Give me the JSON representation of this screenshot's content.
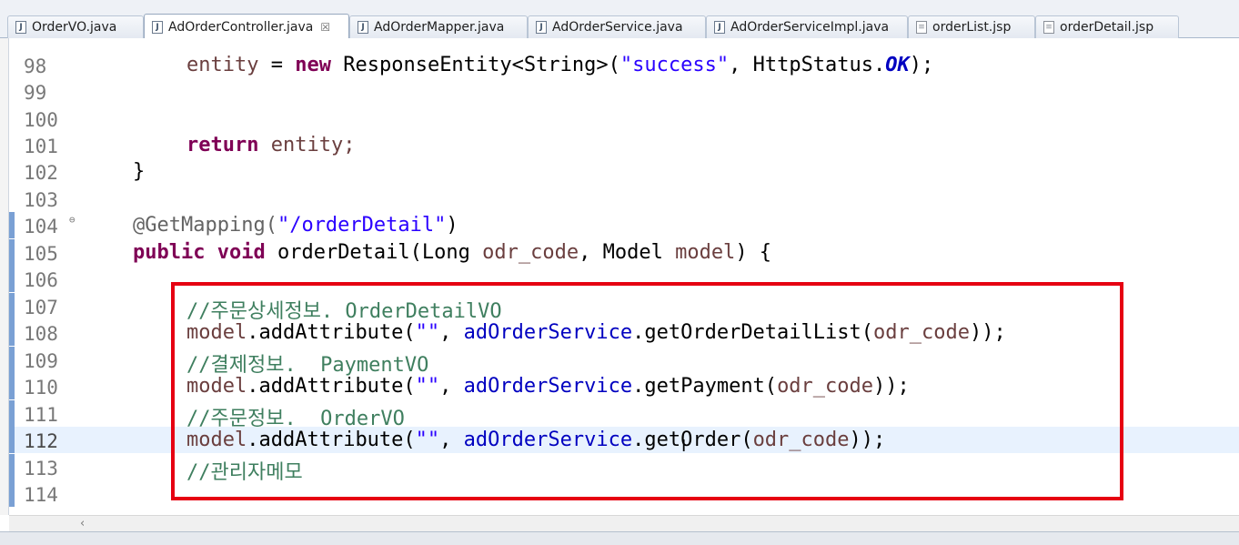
{
  "tabs": [
    {
      "label": "OrderVO.java",
      "type": "java"
    },
    {
      "label": "AdOrderController.java",
      "type": "java",
      "active": true,
      "close": "☒"
    },
    {
      "label": "AdOrderMapper.java",
      "type": "java"
    },
    {
      "label": "AdOrderService.java",
      "type": "java"
    },
    {
      "label": "AdOrderServiceImpl.java",
      "type": "java"
    },
    {
      "label": "orderList.jsp",
      "type": "jsp"
    },
    {
      "label": "orderDetail.jsp",
      "type": "jsp"
    }
  ],
  "editor": {
    "lines": {
      "98": "98",
      "99": "99",
      "100": "100",
      "101": "101",
      "102": "102",
      "103": "103",
      "104": "104",
      "105": "105",
      "106": "106",
      "107": "107",
      "108": "108",
      "109": "109",
      "110": "110",
      "111": "111",
      "112": "112",
      "113": "113",
      "114": "114"
    },
    "code": {
      "l98_entity": "entity",
      "l98_eq": " = ",
      "l98_new": "new",
      "l98_type": " ResponseEntity<String>(",
      "l98_str": "\"success\"",
      "l98_comma": ", HttpStatus.",
      "l98_ok": "OK",
      "l98_end": ");",
      "l101_return": "return",
      "l101_rest": " entity;",
      "l102": "}",
      "l104_ann": "@GetMapping(",
      "l104_str": "\"/orderDetail\"",
      "l104_end": ")",
      "l105_public": "public",
      "l105_void": "void",
      "l105_sig1": " orderDetail(Long ",
      "l105_param1": "odr_code",
      "l105_sig2": ", Model ",
      "l105_param2": "model",
      "l105_sig3": ") {",
      "l107_comment": "//주문상세정보. OrderDetailVO",
      "l108_model": "model",
      "l108_a": ".addAttribute(",
      "l108_str": "\"\"",
      "l108_b": ", ",
      "l108_svc": "adOrderService",
      "l108_c": ".getOrderDetailList(",
      "l108_arg": "odr_code",
      "l108_d": "));",
      "l109_comment": "//결제정보.  PaymentVO",
      "l110_model": "model",
      "l110_a": ".addAttribute(",
      "l110_str": "\"\"",
      "l110_b": ", ",
      "l110_svc": "adOrderService",
      "l110_c": ".getPayment(",
      "l110_arg": "odr_code",
      "l110_d": "));",
      "l111_comment": "//주문정보.  OrderVO",
      "l112_model": "model",
      "l112_a": ".addAttribute(",
      "l112_str": "\"\"",
      "l112_b": ", ",
      "l112_svc": "adOrderService",
      "l112_c": ".getOrder(",
      "l112_arg": "odr_code",
      "l112_d": "));",
      "l113_comment": "//관리자메모"
    }
  },
  "scrollbar": {
    "left_arrow": "‹"
  },
  "colors": {
    "highlight_box": "#e60012",
    "keyword": "#7f0055",
    "string": "#2a00ff",
    "comment": "#3f7f5f",
    "field": "#0000c0"
  }
}
